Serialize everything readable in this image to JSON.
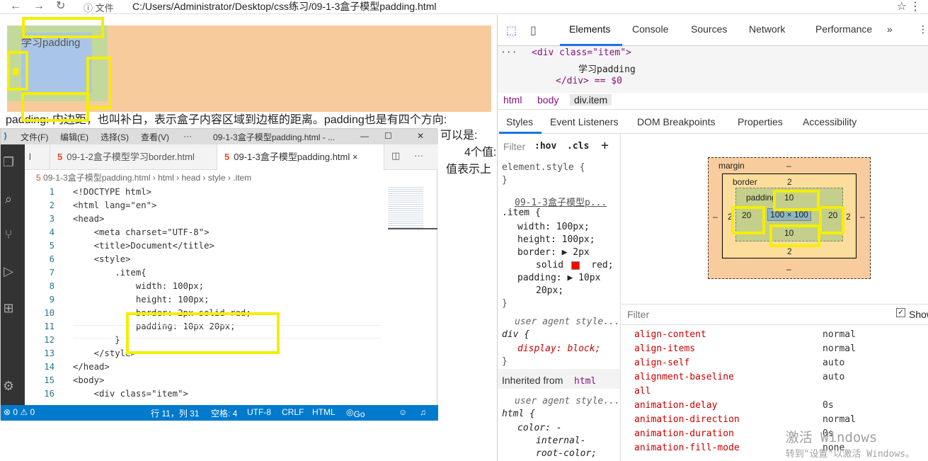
{
  "address_bar": {
    "back_glyph": "←",
    "forward_glyph": "→",
    "reload_glyph": "↻",
    "info_glyph": "ⓘ",
    "file_label": "文件",
    "url": "C:/Users/Administrator/Desktop/css练习/09-1-3盒子模型padding.html",
    "star_glyph": "☆",
    "more_glyph": "⋮"
  },
  "page": {
    "demo_text": "学习padding",
    "paragraph_line1": "padding: 内边距，也叫补白，表示盒子内容区域到边框的距离。padding也是有四个方向:",
    "paragraph_frag2": "可以是:",
    "paragraph_frag3": "值表示上",
    "paragraph_frag4": "4个值:"
  },
  "vscode": {
    "menu": [
      "文件(F)",
      "编辑(E)",
      "选择(S)",
      "查看(V)",
      "···"
    ],
    "window_title": "09-1-3盒子模型padding.html - ...",
    "tabs": [
      {
        "label": "l",
        "active": false
      },
      {
        "label": "09-1-2盒子模型学习border.html",
        "active": false
      },
      {
        "label": "09-1-3盒子模型padding.html",
        "active": true
      }
    ],
    "tab_close": "×",
    "breadcrumb": [
      "09-1-3盒子模型padding.html",
      "html",
      "head",
      "style",
      ".item"
    ],
    "code_lines": [
      {
        "n": "1",
        "t": "<!DOCTYPE html>"
      },
      {
        "n": "2",
        "t": "<html lang=\"en\">"
      },
      {
        "n": "3",
        "t": "<head>"
      },
      {
        "n": "4",
        "t": "    <meta charset=\"UTF-8\">"
      },
      {
        "n": "5",
        "t": "    <title>Document</title>"
      },
      {
        "n": "6",
        "t": "    <style>"
      },
      {
        "n": "7",
        "t": "        .item{"
      },
      {
        "n": "8",
        "t": "            width: 100px;"
      },
      {
        "n": "9",
        "t": "            height: 100px;"
      },
      {
        "n": "10",
        "t": "            border: 2px solid red;"
      },
      {
        "n": "11",
        "t": "            padding: 10px 20px;"
      },
      {
        "n": "12",
        "t": "        }"
      },
      {
        "n": "13",
        "t": "    </style>"
      },
      {
        "n": "14",
        "t": "</head>"
      },
      {
        "n": "15",
        "t": "<body>"
      },
      {
        "n": "16",
        "t": "    <div class=\"item\">"
      }
    ],
    "status": {
      "errors": "⊗ 0 ⚠ 0",
      "position": "行 11，列 31",
      "spaces": "空格: 4",
      "encoding": "UTF-8",
      "eol": "CRLF",
      "language": "HTML",
      "golive": "Go Live"
    }
  },
  "devtools": {
    "tabs": [
      "Elements",
      "Console",
      "Sources",
      "Network",
      "Performance",
      "»"
    ],
    "dom": {
      "ellipsis": "···",
      "line1": "<div class=\"item\">",
      "line2": "学习padding",
      "line3": "</div> == $0"
    },
    "breadcrumbs": [
      "html",
      "body",
      "div.item"
    ],
    "subtabs": [
      "Styles",
      "Event Listeners",
      "DOM Breakpoints",
      "Properties",
      "Accessibility"
    ],
    "styles": {
      "filter_placeholder": "Filter",
      "hov": ":hov",
      "cls": ".cls",
      "plus": "+",
      "element_style": "element.style {",
      "close": "}",
      "source": "09-1-3盒子模型p...",
      "selector": ".item {",
      "width": "width: 100px;",
      "height": "height: 100px;",
      "border1": "border: ▶ 2px",
      "border2": "solid     red;",
      "padding1": "padding: ▶ 10px",
      "padding2": "20px;",
      "ua1": "user agent style...",
      "div": "div {",
      "display": "display: block;",
      "inherited_label": "Inherited from",
      "inherited_tag": "html",
      "ua2": "user agent style...",
      "html": "html {",
      "color1": "color: -",
      "color2": "internal-",
      "color3": "root-color;"
    },
    "boxmodel": {
      "margin_label": "margin",
      "margin_top": "–",
      "margin_bottom": "–",
      "margin_left": "–",
      "margin_right": "–",
      "border_label": "border",
      "border_top": "2",
      "border_bottom": "2",
      "border_left": "2",
      "border_right": "2",
      "padding_label": "padding",
      "padding_top": "10",
      "padding_bottom": "10",
      "padding_left": "20",
      "padding_right": "20",
      "content": "100 × 100"
    },
    "computed": {
      "filter_placeholder": "Filter",
      "show_all": "Show",
      "props": [
        {
          "name": "align-content",
          "value": "normal"
        },
        {
          "name": "align-items",
          "value": "normal"
        },
        {
          "name": "align-self",
          "value": "auto"
        },
        {
          "name": "alignment-baseline",
          "value": "auto"
        },
        {
          "name": "all",
          "value": ""
        },
        {
          "name": "animation-delay",
          "value": "0s"
        },
        {
          "name": "animation-direction",
          "value": "normal"
        },
        {
          "name": "animation-duration",
          "value": "0s"
        },
        {
          "name": "animation-fill-mode",
          "value": "none"
        }
      ]
    },
    "watermark_line1": "激活 Windows",
    "watermark_line2": "转到\"设置\"以激活 Windows。"
  },
  "colors": {
    "accent": "#1a73e8",
    "highlight": "#f4ee00",
    "vscode_status": "#007acc",
    "red_swatch": "#ff0000"
  }
}
